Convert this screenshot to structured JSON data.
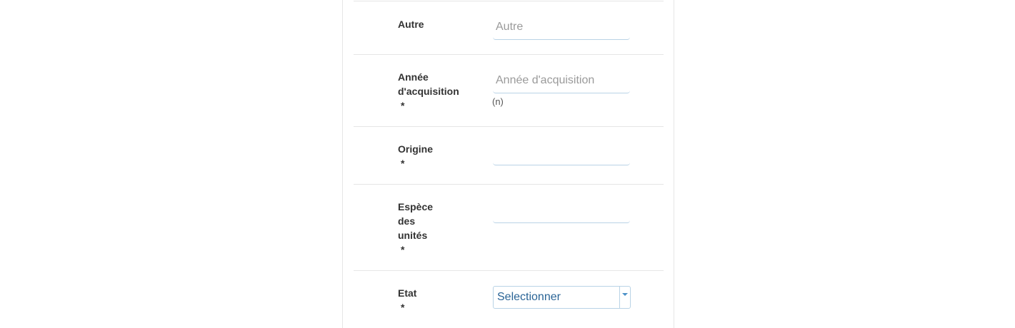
{
  "form": {
    "rows": [
      {
        "label": "Autre",
        "required": "",
        "placeholder": "Autre",
        "value": ""
      },
      {
        "label": "Année d'acquisition",
        "required": "*",
        "placeholder": "Année d'acquisition",
        "value": "",
        "hint": "(n)"
      },
      {
        "label": "Origine",
        "required": "*",
        "placeholder": "",
        "value": ""
      },
      {
        "label": "Espèce des unités",
        "required": "*",
        "placeholder": "",
        "value": ""
      },
      {
        "label": "Etat",
        "required": "*",
        "select_value": "Selectionner"
      }
    ]
  },
  "colors": {
    "border": "#e6e6e6",
    "input_underline": "#b9d3e6",
    "select_text": "#2a6496",
    "caret": "#4a90c8"
  },
  "icons": {
    "select_toggle": "caret-down-icon"
  }
}
